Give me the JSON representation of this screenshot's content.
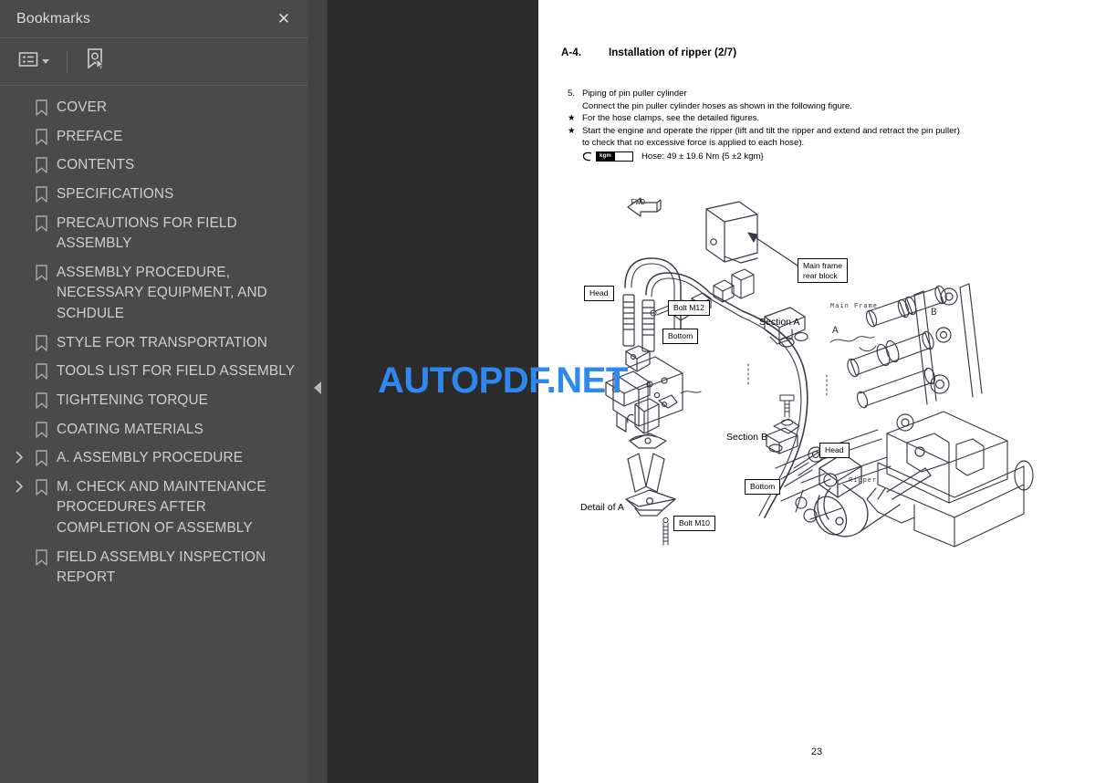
{
  "sidebar": {
    "title": "Bookmarks",
    "close_label": "✕",
    "toolbar": {
      "options_icon": "list-options-icon",
      "dropdown_icon": "chevron-down-icon",
      "new_bookmark_icon": "new-bookmark-icon"
    },
    "items": [
      {
        "label": "COVER",
        "expandable": false
      },
      {
        "label": "PREFACE",
        "expandable": false
      },
      {
        "label": "CONTENTS",
        "expandable": false
      },
      {
        "label": "SPECIFICATIONS",
        "expandable": false
      },
      {
        "label": "PRECAUTIONS FOR FIELD ASSEMBLY",
        "expandable": false
      },
      {
        "label": "ASSEMBLY PROCEDURE, NECESSARY EQUIPMENT, AND SCHDULE",
        "expandable": false
      },
      {
        "label": "STYLE FOR TRANSPORTATION",
        "expandable": false
      },
      {
        "label": "TOOLS LIST FOR FIELD ASSEMBLY",
        "expandable": false
      },
      {
        "label": "TIGHTENING TORQUE",
        "expandable": false
      },
      {
        "label": "COATING MATERIALS",
        "expandable": false
      },
      {
        "label": "A. ASSEMBLY PROCEDURE",
        "expandable": true
      },
      {
        "label": "M. CHECK AND MAINTENANCE PROCEDURES AFTER COMPLETION OF ASSEMBLY",
        "expandable": true
      },
      {
        "label": "FIELD ASSEMBLY INSPECTION REPORT",
        "expandable": false
      }
    ]
  },
  "splitter": {
    "collapse_icon": "triangle-left-icon"
  },
  "watermark": {
    "text": "AUTOPDF.NET",
    "color": "#2f87f0"
  },
  "document": {
    "heading_number": "A-4.",
    "heading_title": "Installation of ripper (2/7)",
    "step_number": "5.",
    "step_title": "Piping of pin puller cylinder",
    "step_detail": "Connect the pin puller cylinder hoses as shown in the following figure.",
    "bullet_marker": "★",
    "bullets": [
      "For the hose clamps, see the detailed figures.",
      "Start the engine and operate the ripper (lift and tilt the ripper and extend and retract the pin puller)"
    ],
    "bullet2_cont": "to check that no excessive force is applied to each hose).",
    "torque_symbol_label": "kgm",
    "torque_text": "Hose: 49 ± 19.6 Nm {5 ±2 kgm}",
    "page_number": "23",
    "figure": {
      "callouts": [
        {
          "text": "Main frame\nrear block",
          "name": "callout-main-frame-rear-block"
        },
        {
          "text": "Head",
          "name": "callout-head-upper"
        },
        {
          "text": "Bolt M12",
          "name": "callout-bolt-m12"
        },
        {
          "text": "Bottom",
          "name": "callout-bottom-upper"
        },
        {
          "text": "Bolt M10",
          "name": "callout-bolt-m10"
        },
        {
          "text": "Head",
          "name": "callout-head-lower"
        },
        {
          "text": "Bottom",
          "name": "callout-bottom-lower"
        }
      ],
      "labels": [
        {
          "text": "Section A",
          "name": "label-section-a"
        },
        {
          "text": "Section B",
          "name": "label-section-b"
        },
        {
          "text": "Detail of A",
          "name": "label-detail-of-a"
        },
        {
          "text": "FWD",
          "name": "label-fwd-arrow"
        },
        {
          "text": "Main Frame",
          "name": "label-main-frame"
        },
        {
          "text": "Ripper",
          "name": "label-ripper"
        },
        {
          "text": "A",
          "name": "label-marker-a"
        },
        {
          "text": "B",
          "name": "label-marker-b"
        }
      ],
      "callout_main_frame_rear_block_l1": "Main frame",
      "callout_main_frame_rear_block_l2": "rear block",
      "callout_head_upper": "Head",
      "callout_bolt_m12": "Bolt M12",
      "callout_bottom_upper": "Bottom",
      "callout_bolt_m10": "Bolt M10",
      "callout_head_lower": "Head",
      "callout_bottom_lower": "Bottom",
      "label_section_a": "Section A",
      "label_section_b": "Section B",
      "label_detail_of_a": "Detail of A",
      "label_fwd": "FWD",
      "label_main_frame": "Main Frame",
      "label_ripper": "Ripper",
      "label_marker_a": "A",
      "label_marker_b": "B"
    }
  }
}
